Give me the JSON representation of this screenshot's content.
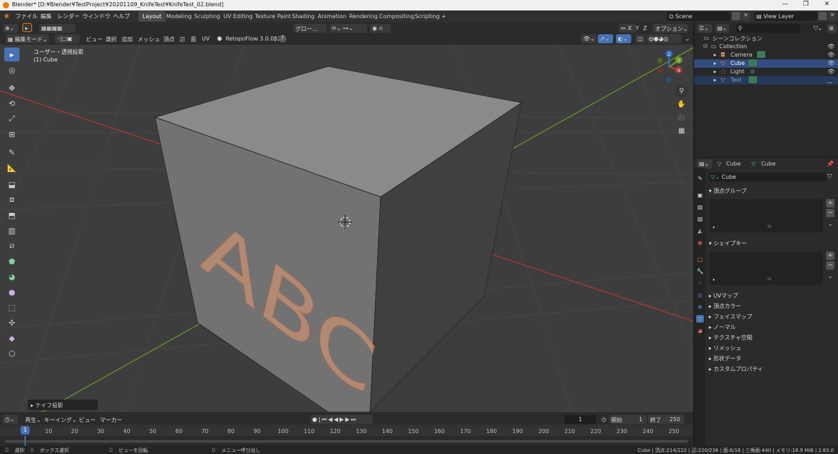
{
  "window": {
    "title": "Blender* [D:¥Blender¥TestProject¥20201109_KnifeTest¥KnifeTest_02.blend]",
    "minimize": "—",
    "maximize": "❐",
    "close": "✕"
  },
  "menu": [
    "ファイル",
    "編集",
    "レンダー",
    "ウィンドウ",
    "ヘルプ"
  ],
  "workspaces": [
    "Layout",
    "Modeling",
    "Sculpting",
    "UV Editing",
    "Texture Paint",
    "Shading",
    "Animation",
    "Rendering",
    "Compositing",
    "Scripting",
    "+"
  ],
  "topright": {
    "scene": "Scene",
    "viewlayer": "View Layer"
  },
  "header": {
    "mode": "編集モード",
    "view": "ビュー",
    "select": "選択",
    "add": "追加",
    "mesh": "メッシュ",
    "vertex": "頂点",
    "edge": "辺",
    "face": "面",
    "uv": "UV",
    "addon": "RetopoFlow 3.0.0β2",
    "help": "?",
    "transform": "グロー...",
    "options": "オプション",
    "x": "X",
    "y": "Y",
    "z": "Z"
  },
  "viewport": {
    "view_name": "ユーザー・透視投影",
    "object": "(1) Cube",
    "knife_panel": "ナイフ投影",
    "letters": "ABC"
  },
  "gizmo": {
    "x": "X",
    "y": "Y",
    "z": "Z"
  },
  "outliner": {
    "root": "シーンコレクション",
    "collection": "Collection",
    "items": [
      {
        "label": "Camera",
        "selected": false
      },
      {
        "label": "Cube",
        "selected": true
      },
      {
        "label": "Light",
        "selected": false
      },
      {
        "label": "Text",
        "selected": true
      }
    ]
  },
  "properties": {
    "crumb_object": "Cube",
    "crumb_data": "Cube",
    "name_field": "Cube",
    "sections": [
      "頂点グループ",
      "シェイプキー"
    ],
    "collapsed": [
      "UVマップ",
      "頂点カラー",
      "フェイスマップ",
      "ノーマル",
      "テクスチャ空間",
      "リメッシュ",
      "形状データ",
      "カスタムプロパティ"
    ],
    "plus": "+",
    "minus": "−"
  },
  "timeline": {
    "menus": [
      "再生",
      "キーイング",
      "ビュー",
      "マーカー"
    ],
    "current_frame": "1",
    "start_label": "開始",
    "start": "1",
    "end_label": "終了",
    "end": "250",
    "ticks": [
      "1",
      "10",
      "20",
      "30",
      "40",
      "50",
      "60",
      "70",
      "80",
      "90",
      "100",
      "110",
      "120",
      "130",
      "140",
      "150",
      "160",
      "170",
      "180",
      "190",
      "200",
      "210",
      "220",
      "230",
      "240",
      "250"
    ]
  },
  "status": {
    "select": "選択",
    "box_select": "ボックス選択",
    "rotate": "ビューを回転",
    "menu": "メニュー呼び出し",
    "stats": "Cube | 頂点:214/222 | 辺:220/236 | 面:6/16 | 三角面:440 | メモリ:18.9 MiB | 2.83.0"
  },
  "colors": {
    "accent": "#4772b3",
    "selected_row": "#334d80",
    "x_axis": "#b33a3a",
    "y_axis": "#6f9a2a",
    "z_axis": "#2f6fc8",
    "text_object": "#e0a07a"
  }
}
